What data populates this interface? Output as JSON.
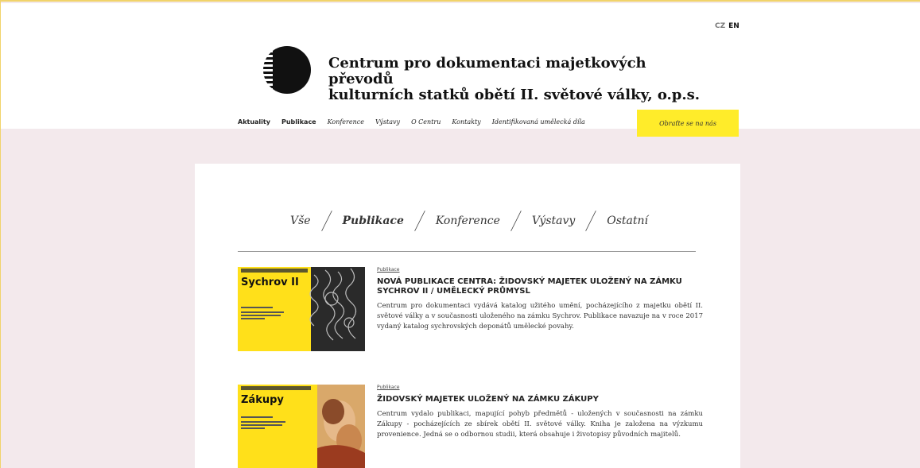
{
  "lang": {
    "cz": "CZ",
    "en": "EN"
  },
  "site": {
    "title_line1": "Centrum pro dokumentaci majetkových převodů",
    "title_line2": "kulturních statků obětí II. světové války, o.p.s."
  },
  "nav": {
    "items": [
      "Aktuality",
      "Publikace",
      "Konference",
      "Výstavy",
      "O Centru",
      "Kontakty",
      "Identifikovaná umělecká díla"
    ],
    "contact": "Obraťte se na nás"
  },
  "filters": [
    "Vše",
    "Publikace",
    "Konference",
    "Výstavy",
    "Ostatní"
  ],
  "articles": [
    {
      "category": "Publikace",
      "title": "NOVÁ PUBLIKACE CENTRA: ŽIDOVSKÝ MAJETEK ULOŽENÝ NA ZÁMKU SYCHROV II / UMĚLECKÝ PRŮMYSL",
      "description": "Centrum pro dokumentaci vydává katalog užitého umění, pocházejícího z majetku obětí II. světové války a v současnosti uloženého na zámku Sychrov. Publikace navazuje na v roce 2017 vydaný katalog sychrovských deponátů umělecké povahy.",
      "thumb_title": "Sychrov II"
    },
    {
      "category": "Publikace",
      "title": "ŽIDOVSKÝ MAJETEK ULOŽENÝ NA ZÁMKU ZÁKUPY",
      "description": "Centrum vydalo publikaci, mapující pohyb předmětů - uložených v současnosti na zámku Zákupy - pocházejících ze sbírek obětí II. světové války. Kniha je založena na výzkumu provenience. Jedná se o odbornou studii, která obsahuje i životopisy původních majitelů.",
      "thumb_title": "Zákupy"
    }
  ],
  "colors": {
    "accent": "#ffec2a",
    "background": "#f3e9ec"
  }
}
